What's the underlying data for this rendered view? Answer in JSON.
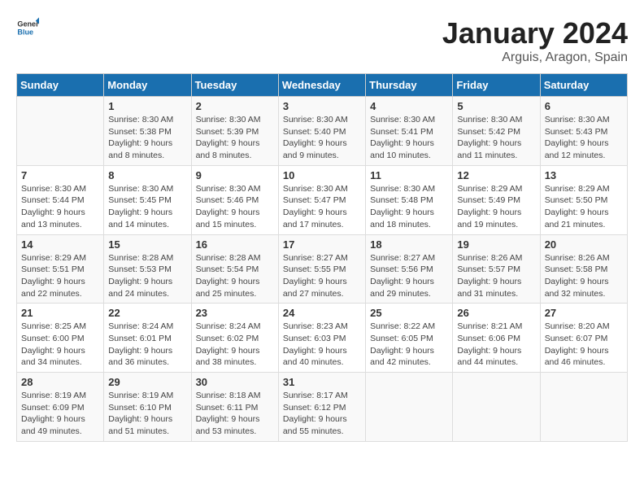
{
  "header": {
    "logo_general": "General",
    "logo_blue": "Blue",
    "month": "January 2024",
    "location": "Arguis, Aragon, Spain"
  },
  "days_of_week": [
    "Sunday",
    "Monday",
    "Tuesday",
    "Wednesday",
    "Thursday",
    "Friday",
    "Saturday"
  ],
  "weeks": [
    [
      {
        "day": "",
        "content": ""
      },
      {
        "day": "1",
        "content": "Sunrise: 8:30 AM\nSunset: 5:38 PM\nDaylight: 9 hours\nand 8 minutes."
      },
      {
        "day": "2",
        "content": "Sunrise: 8:30 AM\nSunset: 5:39 PM\nDaylight: 9 hours\nand 8 minutes."
      },
      {
        "day": "3",
        "content": "Sunrise: 8:30 AM\nSunset: 5:40 PM\nDaylight: 9 hours\nand 9 minutes."
      },
      {
        "day": "4",
        "content": "Sunrise: 8:30 AM\nSunset: 5:41 PM\nDaylight: 9 hours\nand 10 minutes."
      },
      {
        "day": "5",
        "content": "Sunrise: 8:30 AM\nSunset: 5:42 PM\nDaylight: 9 hours\nand 11 minutes."
      },
      {
        "day": "6",
        "content": "Sunrise: 8:30 AM\nSunset: 5:43 PM\nDaylight: 9 hours\nand 12 minutes."
      }
    ],
    [
      {
        "day": "7",
        "content": "Sunrise: 8:30 AM\nSunset: 5:44 PM\nDaylight: 9 hours\nand 13 minutes."
      },
      {
        "day": "8",
        "content": "Sunrise: 8:30 AM\nSunset: 5:45 PM\nDaylight: 9 hours\nand 14 minutes."
      },
      {
        "day": "9",
        "content": "Sunrise: 8:30 AM\nSunset: 5:46 PM\nDaylight: 9 hours\nand 15 minutes."
      },
      {
        "day": "10",
        "content": "Sunrise: 8:30 AM\nSunset: 5:47 PM\nDaylight: 9 hours\nand 17 minutes."
      },
      {
        "day": "11",
        "content": "Sunrise: 8:30 AM\nSunset: 5:48 PM\nDaylight: 9 hours\nand 18 minutes."
      },
      {
        "day": "12",
        "content": "Sunrise: 8:29 AM\nSunset: 5:49 PM\nDaylight: 9 hours\nand 19 minutes."
      },
      {
        "day": "13",
        "content": "Sunrise: 8:29 AM\nSunset: 5:50 PM\nDaylight: 9 hours\nand 21 minutes."
      }
    ],
    [
      {
        "day": "14",
        "content": "Sunrise: 8:29 AM\nSunset: 5:51 PM\nDaylight: 9 hours\nand 22 minutes."
      },
      {
        "day": "15",
        "content": "Sunrise: 8:28 AM\nSunset: 5:53 PM\nDaylight: 9 hours\nand 24 minutes."
      },
      {
        "day": "16",
        "content": "Sunrise: 8:28 AM\nSunset: 5:54 PM\nDaylight: 9 hours\nand 25 minutes."
      },
      {
        "day": "17",
        "content": "Sunrise: 8:27 AM\nSunset: 5:55 PM\nDaylight: 9 hours\nand 27 minutes."
      },
      {
        "day": "18",
        "content": "Sunrise: 8:27 AM\nSunset: 5:56 PM\nDaylight: 9 hours\nand 29 minutes."
      },
      {
        "day": "19",
        "content": "Sunrise: 8:26 AM\nSunset: 5:57 PM\nDaylight: 9 hours\nand 31 minutes."
      },
      {
        "day": "20",
        "content": "Sunrise: 8:26 AM\nSunset: 5:58 PM\nDaylight: 9 hours\nand 32 minutes."
      }
    ],
    [
      {
        "day": "21",
        "content": "Sunrise: 8:25 AM\nSunset: 6:00 PM\nDaylight: 9 hours\nand 34 minutes."
      },
      {
        "day": "22",
        "content": "Sunrise: 8:24 AM\nSunset: 6:01 PM\nDaylight: 9 hours\nand 36 minutes."
      },
      {
        "day": "23",
        "content": "Sunrise: 8:24 AM\nSunset: 6:02 PM\nDaylight: 9 hours\nand 38 minutes."
      },
      {
        "day": "24",
        "content": "Sunrise: 8:23 AM\nSunset: 6:03 PM\nDaylight: 9 hours\nand 40 minutes."
      },
      {
        "day": "25",
        "content": "Sunrise: 8:22 AM\nSunset: 6:05 PM\nDaylight: 9 hours\nand 42 minutes."
      },
      {
        "day": "26",
        "content": "Sunrise: 8:21 AM\nSunset: 6:06 PM\nDaylight: 9 hours\nand 44 minutes."
      },
      {
        "day": "27",
        "content": "Sunrise: 8:20 AM\nSunset: 6:07 PM\nDaylight: 9 hours\nand 46 minutes."
      }
    ],
    [
      {
        "day": "28",
        "content": "Sunrise: 8:19 AM\nSunset: 6:09 PM\nDaylight: 9 hours\nand 49 minutes."
      },
      {
        "day": "29",
        "content": "Sunrise: 8:19 AM\nSunset: 6:10 PM\nDaylight: 9 hours\nand 51 minutes."
      },
      {
        "day": "30",
        "content": "Sunrise: 8:18 AM\nSunset: 6:11 PM\nDaylight: 9 hours\nand 53 minutes."
      },
      {
        "day": "31",
        "content": "Sunrise: 8:17 AM\nSunset: 6:12 PM\nDaylight: 9 hours\nand 55 minutes."
      },
      {
        "day": "",
        "content": ""
      },
      {
        "day": "",
        "content": ""
      },
      {
        "day": "",
        "content": ""
      }
    ]
  ]
}
